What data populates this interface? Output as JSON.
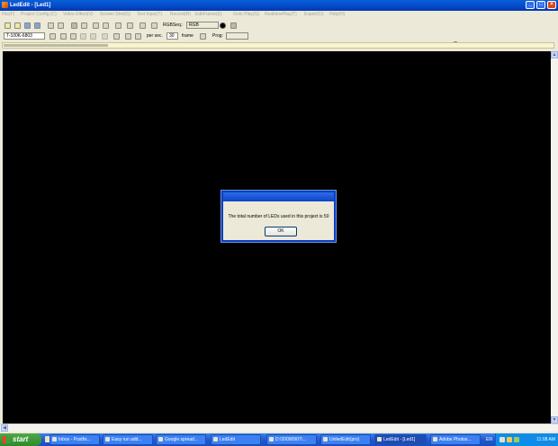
{
  "window": {
    "title": "LedEdit - [Led1]"
  },
  "menu": [
    {
      "label": "File(F)"
    },
    {
      "label": "Project Config.(C)"
    },
    {
      "label": "Video Effect(V)"
    },
    {
      "label": "Screen Shot(S)"
    },
    {
      "label": "Text Input(T)"
    },
    {
      "label": "Record(R)"
    },
    {
      "label": "EditFrame(E)"
    },
    {
      "label": "Goto Play(G)"
    },
    {
      "label": "RealtimePlay(T)"
    },
    {
      "label": "Export(O)"
    },
    {
      "label": "Help(H)"
    }
  ],
  "toolbar1": {
    "rgbseq_label": "RGBSeq.:",
    "rgbseq_value": "RGB"
  },
  "toolbar2": {
    "device_value": "T-100K-6803",
    "per_sec_label": "per sec.",
    "fps_value": "30",
    "frame_label": "frame",
    "prog_label": "Prog:",
    "prog_value": ""
  },
  "progress": {
    "fraction": 0.19
  },
  "dialog": {
    "message": "The total number of LEDs used in this project is 50",
    "ok_label": "OK"
  },
  "taskbar": {
    "start_label": "start",
    "tasks": [
      {
        "label": "Inbox - Postfix..."
      },
      {
        "label": "Easy run add..."
      },
      {
        "label": "Google spread..."
      },
      {
        "label": "LedEdit"
      },
      {
        "label": "D:\\20090907\\..."
      },
      {
        "label": "UniledEdit(pro)"
      },
      {
        "label": "LedEdit - [Led1]"
      },
      {
        "label": "Adobe Photos..."
      }
    ],
    "language": "EN",
    "clock": "11:08 AM"
  },
  "colors": {
    "canvas": "#000000",
    "titlebar": "#0348C8",
    "taskbar": "#225ACA",
    "start": "#3BA33A"
  }
}
